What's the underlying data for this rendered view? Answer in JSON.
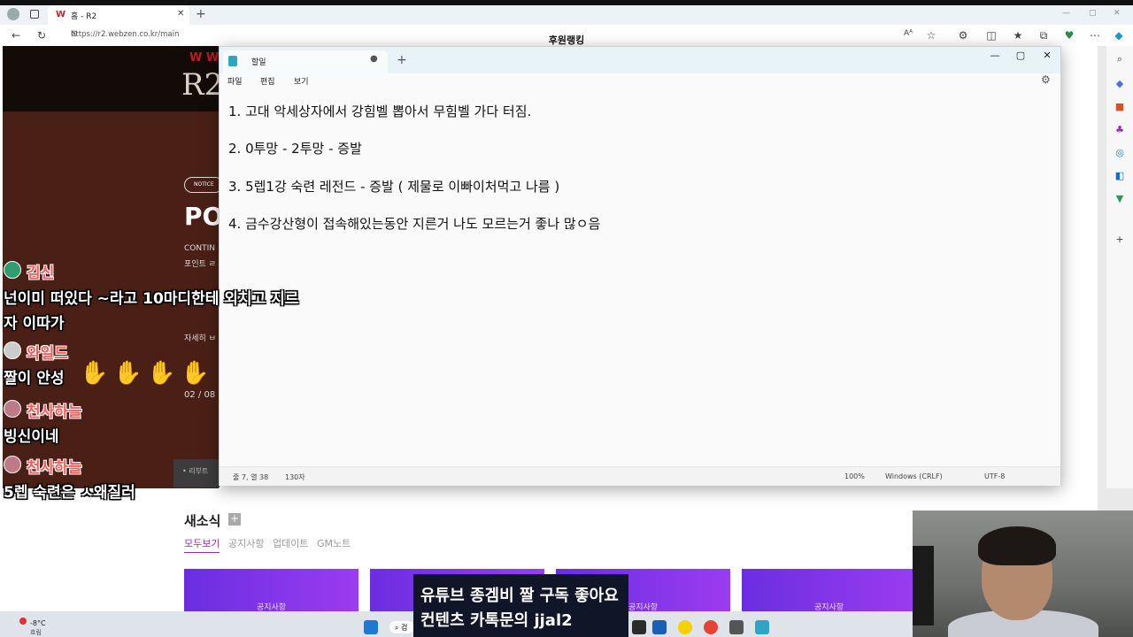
{
  "browser": {
    "tab_title": "홈 - R2",
    "tab_logo": "W",
    "address": "https://r2.webzen.co.kr/main",
    "page_overlay_title": "후원랭킹"
  },
  "site": {
    "logo": "R2",
    "notice_badge": "NOTICE",
    "headline_fragment": "PO",
    "sub1": "CONTIN",
    "sub2": "포인트 ㄹ",
    "detail": "자세히 ㅂ",
    "date_fragment": "02 / 08",
    "review": "• 리부트",
    "news_title": "새소식",
    "news_plus": "+",
    "news_tabs": [
      "모두보기",
      "공지사항",
      "업데이트",
      "GM노트"
    ],
    "cards": [
      "공지사항",
      "공지사항",
      "공지사항",
      "공지사항"
    ]
  },
  "notepad": {
    "title": "할일",
    "menu": [
      "파일",
      "편집",
      "보기"
    ],
    "lines": [
      "1. 고대 악세상자에서 강힘벨 뽑아서 무힘벨 가다 터짐.",
      "2. 0투망 - 2투망 - 증발",
      "3. 5렙1강 숙련 레전드 - 증발 ( 제물로 이빠이처먹고 나름 )",
      "4. 금수강산형이 접속해있는동안 지른거 나도 모르는거 좋나 많ㅇ음"
    ],
    "status": {
      "position": "줄 7, 열 38",
      "chars": "130자",
      "zoom": "100%",
      "line_ending": "Windows (CRLF)",
      "encoding": "UTF-8"
    }
  },
  "chat": [
    {
      "user": "김신",
      "msg1": "넌이미 떠있다 ~라고 10마디한테 외치고 지르",
      "msg2": "자 이따가",
      "avatar_color": "#2e9e6e"
    },
    {
      "user": "와일드",
      "msg1": "짤이 안성",
      "avatar_color": "#cccccc"
    },
    {
      "user": "천사하늘",
      "msg1": "빙신이네",
      "avatar_color": "#c07a86"
    },
    {
      "user": "천사하늘",
      "msg1": "5렙 숙련은 ㅅ왜질러",
      "avatar_color": "#c07a86"
    }
  ],
  "caption": {
    "line1": "유튜브 종겜비 짤 구독 좋아요",
    "line2": "컨텐츠 카톡문의 jjal2"
  },
  "taskbar": {
    "temp": "-8°C",
    "weather": "흐림",
    "weather_badge": "1",
    "search_stub": "검"
  }
}
